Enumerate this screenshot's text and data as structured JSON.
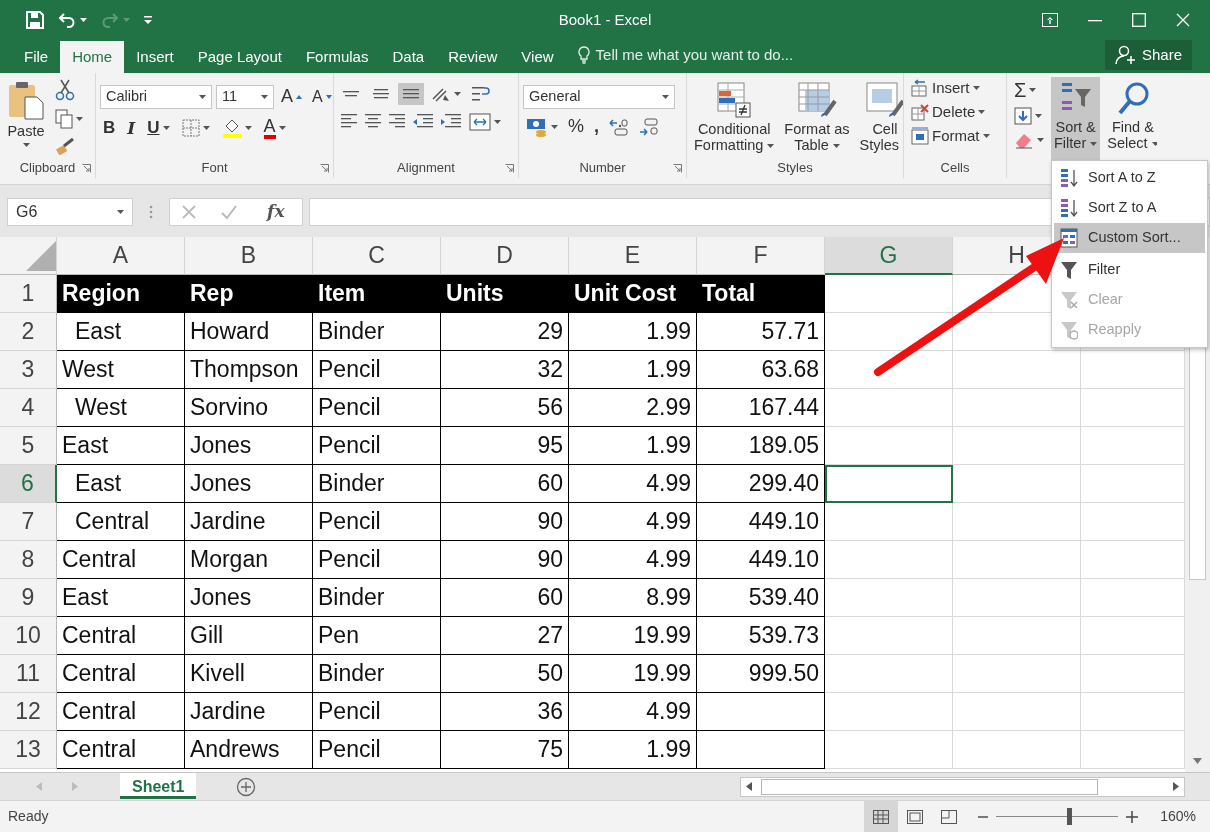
{
  "window": {
    "title": "Book1 - Excel"
  },
  "tabs": [
    {
      "label": "File",
      "selected": false
    },
    {
      "label": "Home",
      "selected": true
    },
    {
      "label": "Insert",
      "selected": false
    },
    {
      "label": "Page Layout",
      "selected": false
    },
    {
      "label": "Formulas",
      "selected": false
    },
    {
      "label": "Data",
      "selected": false
    },
    {
      "label": "Review",
      "selected": false
    },
    {
      "label": "View",
      "selected": false
    }
  ],
  "tell_me": "Tell me what you want to do...",
  "share": "Share",
  "ribbon": {
    "clipboard": {
      "label": "Clipboard",
      "paste": "Paste"
    },
    "font": {
      "label": "Font",
      "font_name": "Calibri",
      "font_size": "11",
      "grow": "A",
      "shrink": "A",
      "bold": "B",
      "italic": "I",
      "underline": "U",
      "font_color": "A"
    },
    "alignment": {
      "label": "Alignment",
      "vertical_align": [
        {
          "selected": false
        },
        {
          "selected": false
        },
        {
          "selected": true
        }
      ]
    },
    "number": {
      "label": "Number",
      "format": "General",
      "percent": "%",
      "comma": ","
    },
    "styles": {
      "label": "Styles",
      "buttons": [
        "Conditional\nFormatting",
        "Format as\nTable",
        "Cell\nStyles"
      ]
    },
    "cells": {
      "label": "Cells",
      "buttons": [
        "Insert",
        "Delete",
        "Format"
      ]
    },
    "editing": {
      "autosum": "Σ",
      "buttons": [
        {
          "label": "Sort &\nFilter",
          "selected": true
        },
        {
          "label": "Find &\nSelect",
          "selected": false
        }
      ]
    }
  },
  "formula_bar": {
    "name_box": "G6",
    "fx": "fx"
  },
  "sheet": {
    "columns": [
      {
        "label": "A",
        "selected": false,
        "numeric": false
      },
      {
        "label": "B",
        "selected": false,
        "numeric": false
      },
      {
        "label": "C",
        "selected": false,
        "numeric": false
      },
      {
        "label": "D",
        "selected": false,
        "numeric": true
      },
      {
        "label": "E",
        "selected": false,
        "numeric": true
      },
      {
        "label": "F",
        "selected": false,
        "numeric": true
      },
      {
        "label": "G",
        "selected": true,
        "numeric": false
      },
      {
        "label": "H",
        "selected": false,
        "numeric": false
      }
    ],
    "rows": [
      {
        "number": "1",
        "selected": false,
        "kind": "header",
        "indented": false,
        "cells": [
          "Region",
          "Rep",
          "Item",
          "Units",
          "Unit Cost",
          "Total"
        ]
      },
      {
        "number": "2",
        "selected": false,
        "kind": "data",
        "indented": true,
        "cells": [
          "East",
          "Howard",
          "Binder",
          "29",
          "1.99",
          "57.71"
        ]
      },
      {
        "number": "3",
        "selected": false,
        "kind": "data",
        "indented": false,
        "cells": [
          "West",
          "Thompson",
          "Pencil",
          "32",
          "1.99",
          "63.68"
        ]
      },
      {
        "number": "4",
        "selected": false,
        "kind": "data",
        "indented": true,
        "cells": [
          "West",
          "Sorvino",
          "Pencil",
          "56",
          "2.99",
          "167.44"
        ]
      },
      {
        "number": "5",
        "selected": false,
        "kind": "data",
        "indented": false,
        "cells": [
          "East",
          "Jones",
          "Pencil",
          "95",
          "1.99",
          "189.05"
        ]
      },
      {
        "number": "6",
        "selected": true,
        "kind": "data",
        "indented": true,
        "cells": [
          "East",
          "Jones",
          "Binder",
          "60",
          "4.99",
          "299.40"
        ]
      },
      {
        "number": "7",
        "selected": false,
        "kind": "data",
        "indented": true,
        "cells": [
          "Central",
          "Jardine",
          "Pencil",
          "90",
          "4.99",
          "449.10"
        ]
      },
      {
        "number": "8",
        "selected": false,
        "kind": "data",
        "indented": false,
        "cells": [
          "Central",
          "Morgan",
          "Pencil",
          "90",
          "4.99",
          "449.10"
        ]
      },
      {
        "number": "9",
        "selected": false,
        "kind": "data",
        "indented": false,
        "cells": [
          "East",
          "Jones",
          "Binder",
          "60",
          "8.99",
          "539.40"
        ]
      },
      {
        "number": "10",
        "selected": false,
        "kind": "data",
        "indented": false,
        "cells": [
          "Central",
          "Gill",
          "Pen",
          "27",
          "19.99",
          "539.73"
        ]
      },
      {
        "number": "11",
        "selected": false,
        "kind": "data",
        "indented": false,
        "cells": [
          "Central",
          "Kivell",
          "Binder",
          "50",
          "19.99",
          "999.50"
        ]
      },
      {
        "number": "12",
        "selected": false,
        "kind": "data",
        "indented": false,
        "cells": [
          "Central",
          "Jardine",
          "Pencil",
          "36",
          "4.99"
        ]
      },
      {
        "number": "13",
        "selected": false,
        "kind": "data",
        "indented": false,
        "cells": [
          "Central",
          "Andrews",
          "Pencil",
          "75",
          "1.99"
        ]
      }
    ]
  },
  "sort_menu": {
    "items": [
      {
        "kind": "ascending",
        "label": "Sort A to Z",
        "selected": false,
        "disabled": false
      },
      {
        "kind": "descending",
        "label": "Sort Z to A",
        "selected": false,
        "disabled": false
      },
      {
        "kind": "custom",
        "label": "Custom Sort...",
        "selected": true,
        "disabled": false
      },
      {
        "kind": "filter",
        "label": "Filter",
        "selected": false,
        "disabled": false
      },
      {
        "kind": "clear",
        "label": "Clear",
        "selected": false,
        "disabled": true
      },
      {
        "kind": "reapply",
        "label": "Reapply",
        "selected": false,
        "disabled": true
      }
    ]
  },
  "sheet_tabs": [
    {
      "label": "Sheet1",
      "selected": true
    }
  ],
  "status_bar": {
    "text": "Ready",
    "zoom": "160%",
    "zoom_slider": {
      "level": 0.6
    }
  }
}
